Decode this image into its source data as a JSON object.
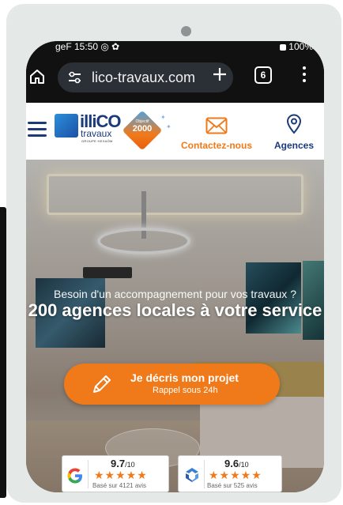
{
  "status_bar": {
    "left_text": "geF 15:50 ◎ ✿",
    "right_text": "100%"
  },
  "browser": {
    "url": "lico-travaux.com",
    "tab_count": "6",
    "icons": [
      "home-icon",
      "site-settings-icon",
      "new-tab-plus-icon",
      "tabs-switcher-icon",
      "more-menu-icon"
    ]
  },
  "site_header": {
    "logo": {
      "word": "illiCO",
      "sub": "travaux",
      "group": "GROUPE HEXAÔM",
      "badge_small": "Objectif",
      "badge_year": "2000"
    },
    "contact_label": "Contactez-nous",
    "agences_label": "Agences"
  },
  "hero": {
    "subtitle": "Besoin d'un accompagnement pour vos travaux ?",
    "title": "200 agences locales à votre service",
    "cta_label": "Je décris mon projet",
    "cta_sub": "Rappel sous 24h"
  },
  "reviews": [
    {
      "source_icon": "google-icon",
      "score": "9.7",
      "scale": "/10",
      "stars": "★★★★★",
      "note": "Basé sur 4121 avis"
    },
    {
      "source_icon": "review-platform-icon",
      "score": "9.6",
      "scale": "/10",
      "stars": "★★★★★",
      "note": "Basé sur 525 avis"
    }
  ],
  "colors": {
    "brand_blue": "#1b3a7a",
    "brand_orange": "#f07a1a",
    "frame_grey": "#e4e8e6"
  }
}
